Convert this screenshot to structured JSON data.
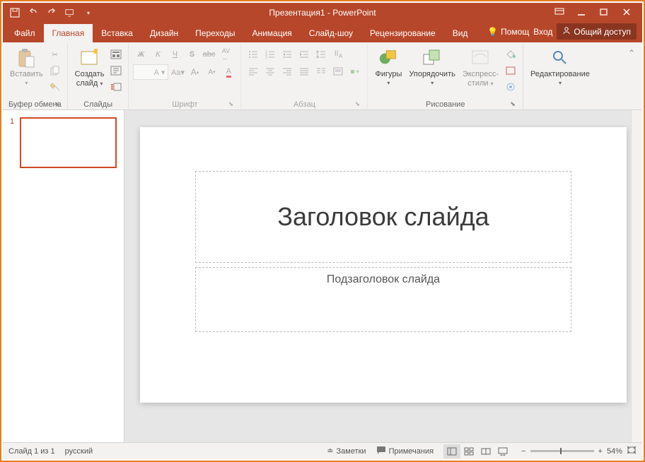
{
  "titlebar": {
    "title": "Презентация1 - PowerPoint"
  },
  "tabs": {
    "file": "Файл",
    "home": "Главная",
    "insert": "Вставка",
    "design": "Дизайн",
    "transitions": "Переходы",
    "animations": "Анимация",
    "slideshow": "Слайд-шоу",
    "review": "Рецензирование",
    "view": "Вид",
    "help": "Помощ",
    "signin": "Вход",
    "share": "Общий доступ"
  },
  "ribbon": {
    "clipboard": {
      "label": "Буфер обмена",
      "paste": "Вставить"
    },
    "slides": {
      "label": "Слайды",
      "new_slide_l1": "Создать",
      "new_slide_l2": "слайд"
    },
    "font": {
      "label": "Шрифт"
    },
    "paragraph": {
      "label": "Абзац"
    },
    "drawing": {
      "label": "Рисование",
      "shapes": "Фигуры",
      "arrange": "Упорядочить",
      "quick_l1": "Экспресс-",
      "quick_l2": "стили"
    },
    "editing": {
      "label": "Редактирование"
    }
  },
  "slide": {
    "number": "1",
    "title_placeholder": "Заголовок слайда",
    "subtitle_placeholder": "Подзаголовок слайда"
  },
  "status": {
    "slide_of": "Слайд 1 из 1",
    "language": "русский",
    "notes": "Заметки",
    "comments": "Примечания",
    "zoom": "54%"
  }
}
